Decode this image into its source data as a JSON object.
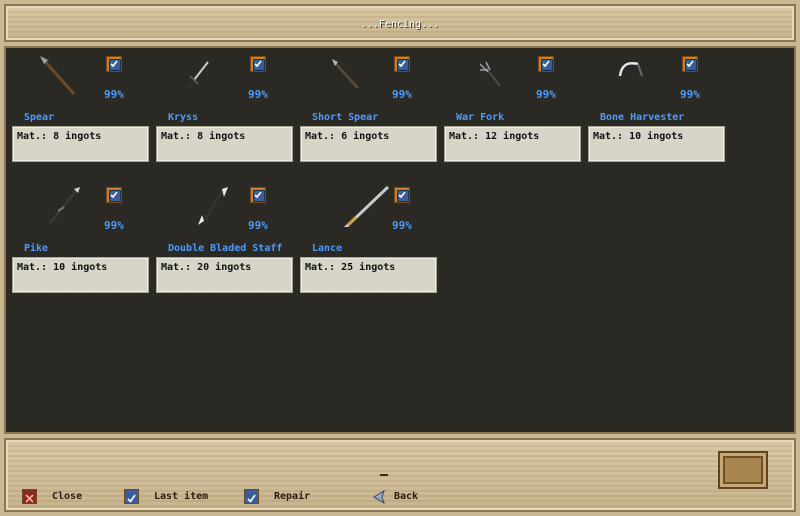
{
  "window": {
    "title": "...Fencing..."
  },
  "items": [
    {
      "name": "Spear",
      "percent": "99%",
      "material": "Mat.: 8 ingots",
      "icon": "spear-icon",
      "checked": true
    },
    {
      "name": "Kryss",
      "percent": "99%",
      "material": "Mat.: 8 ingots",
      "icon": "kryss-icon",
      "checked": true
    },
    {
      "name": "Short Spear",
      "percent": "99%",
      "material": "Mat.: 6 ingots",
      "icon": "short-spear-icon",
      "checked": true
    },
    {
      "name": "War Fork",
      "percent": "99%",
      "material": "Mat.: 12 ingots",
      "icon": "war-fork-icon",
      "checked": true
    },
    {
      "name": "Bone Harvester",
      "percent": "99%",
      "material": "Mat.: 10 ingots",
      "icon": "bone-harvester-icon",
      "checked": true
    },
    {
      "name": "Pike",
      "percent": "99%",
      "material": "Mat.: 10 ingots",
      "icon": "pike-icon",
      "checked": true
    },
    {
      "name": "Double Bladed Staff",
      "percent": "99%",
      "material": "Mat.: 20 ingots",
      "icon": "double-bladed-staff-icon",
      "checked": true
    },
    {
      "name": "Lance",
      "percent": "99%",
      "material": "Mat.: 25 ingots",
      "icon": "lance-icon",
      "checked": true
    }
  ],
  "footer": {
    "close_label": "Close",
    "last_item_label": "Last item",
    "repair_label": "Repair",
    "back_label": "Back",
    "separator": "_"
  },
  "colors": {
    "accent_text": "#4a9bff",
    "panel": "#2b2923",
    "wood": "#c9b892",
    "material_box": "#d7d5c8"
  }
}
